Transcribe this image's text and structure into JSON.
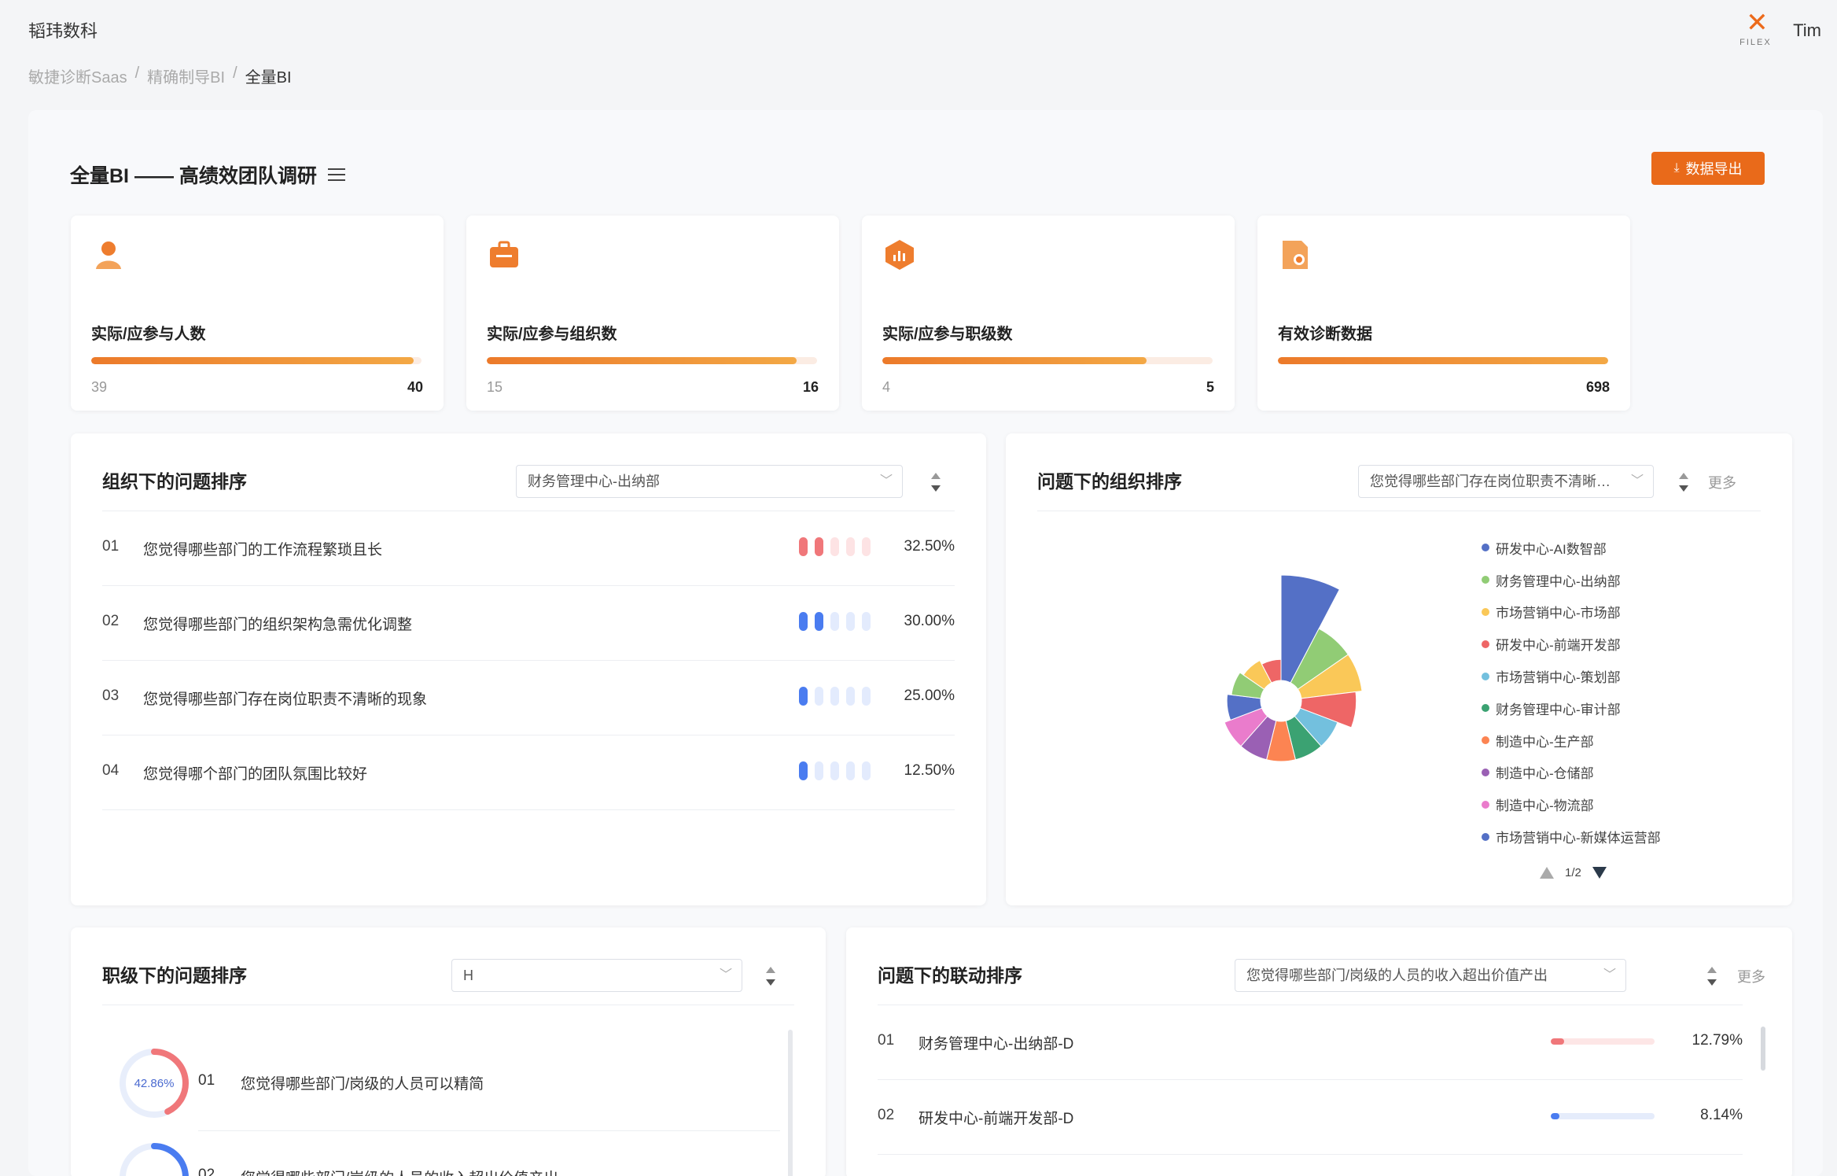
{
  "app": {
    "brand": "韬玮数科",
    "user": "Tim",
    "logo_text": "FILEX"
  },
  "breadcrumb": [
    "敏捷诊断Saas",
    "/",
    "精确制导BI",
    "/",
    "全量BI"
  ],
  "page": {
    "title": "全量BI —— 高绩效团队调研",
    "export_label": "数据导出"
  },
  "kpis": [
    {
      "icon": "person-icon",
      "label": "实际/应参与人数",
      "actual": "39",
      "expected": "40",
      "progress": 0.975
    },
    {
      "icon": "briefcase-icon",
      "label": "实际/应参与组织数",
      "actual": "15",
      "expected": "16",
      "progress": 0.9375
    },
    {
      "icon": "chart-cube-icon",
      "label": "实际/应参与职级数",
      "actual": "4",
      "expected": "5",
      "progress": 0.8
    },
    {
      "icon": "document-icon",
      "label": "有效诊断数据",
      "actual": "",
      "expected": "698",
      "progress": 1.0
    }
  ],
  "org_questions": {
    "title": "组织下的问题排序",
    "select_value": "财务管理中心-出纳部",
    "rows": [
      {
        "num": "01",
        "text": "您觉得哪些部门的工作流程繁琐且长",
        "pct": "32.50%",
        "level": 2,
        "color": "#f0777a",
        "light": "#fde3e4"
      },
      {
        "num": "02",
        "text": "您觉得哪些部门的组织架构急需优化调整",
        "pct": "30.00%",
        "level": 2,
        "color": "#4a7cf0",
        "light": "#e3ebfd"
      },
      {
        "num": "03",
        "text": "您觉得哪些部门存在岗位职责不清晰的现象",
        "pct": "25.00%",
        "level": 1,
        "color": "#4a7cf0",
        "light": "#e3ebfd"
      },
      {
        "num": "04",
        "text": "您觉得哪个部门的团队氛围比较好",
        "pct": "12.50%",
        "level": 1,
        "color": "#4a7cf0",
        "light": "#e3ebfd"
      }
    ]
  },
  "question_orgs": {
    "title": "问题下的组织排序",
    "select_value": "您觉得哪些部门存在岗位职责不清晰的...",
    "more": "更多",
    "pager": "1/2"
  },
  "chart_data": {
    "type": "pie",
    "variant": "rose",
    "labels": [
      "研发中心-AI数智部",
      "财务管理中心-出纳部",
      "市场营销中心-市场部",
      "研发中心-前端开发部",
      "市场营销中心-策划部",
      "财务管理中心-审计部",
      "制造中心-生产部",
      "制造中心-仓储部",
      "制造中心-物流部",
      "市场营销中心-新媒体运营部"
    ],
    "values": [
      100,
      58,
      58,
      52,
      38,
      38,
      38,
      38,
      38,
      32
    ],
    "colors": [
      "#5470c6",
      "#91cc75",
      "#fac858",
      "#ee6666",
      "#73c0de",
      "#3ba272",
      "#fc8452",
      "#9a60b4",
      "#ea7ccc",
      "#5470c6"
    ],
    "extra_slice_colors": [
      "#91cc75",
      "#fac858",
      "#ee6666"
    ],
    "extra_values": [
      28,
      24,
      20
    ],
    "legend_position": "right"
  },
  "grade_questions": {
    "title": "职级下的问题排序",
    "select_value": "H",
    "rows": [
      {
        "num": "01",
        "text": "您觉得哪些部门/岗级的人员可以精简",
        "pct": "42.86%",
        "value": 0.4286,
        "color": "#f0777a",
        "track": "#e8eefb"
      },
      {
        "num": "02",
        "text": "您觉得哪些部门/岗级的人员的收入超出价值产出",
        "pct": "",
        "value": 0.25,
        "color": "#4a7cf0",
        "track": "#e8eefb"
      }
    ]
  },
  "question_links": {
    "title": "问题下的联动排序",
    "select_value": "您觉得哪些部门/岗级的人员的收入超出价值产出",
    "more": "更多",
    "rows": [
      {
        "num": "01",
        "text": "财务管理中心-出纳部-D",
        "pct": "12.79%",
        "value": 0.1279,
        "color": "#f0777a",
        "track": "#fde6e6"
      },
      {
        "num": "02",
        "text": "研发中心-前端开发部-D",
        "pct": "8.14%",
        "value": 0.0814,
        "color": "#4a7cf0",
        "track": "#e5ecfb"
      }
    ]
  }
}
